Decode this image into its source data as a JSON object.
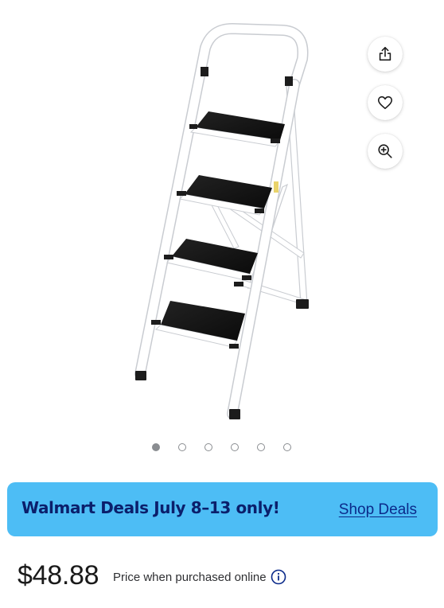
{
  "product": {
    "image_alt": "4-step folding steel step ladder with black anti-slip treads",
    "colors": {
      "frame": "#ffffff",
      "frame_outline": "#c9ccd1",
      "tread": "#141414",
      "feet": "#1c1c1c"
    }
  },
  "actions": {
    "share_icon": "share-icon",
    "favorite_icon": "heart-icon",
    "zoom_icon": "zoom-in-icon"
  },
  "carousel": {
    "total": 6,
    "active_index": 0
  },
  "banner": {
    "title": "Walmart Deals July 8–13 only!",
    "link_label": "Shop Deals",
    "background": "#4dbdf5",
    "text_color": "#0b1f6b"
  },
  "pricing": {
    "price": "$48.88",
    "note": "Price when purchased online",
    "info_icon": "info-icon"
  }
}
